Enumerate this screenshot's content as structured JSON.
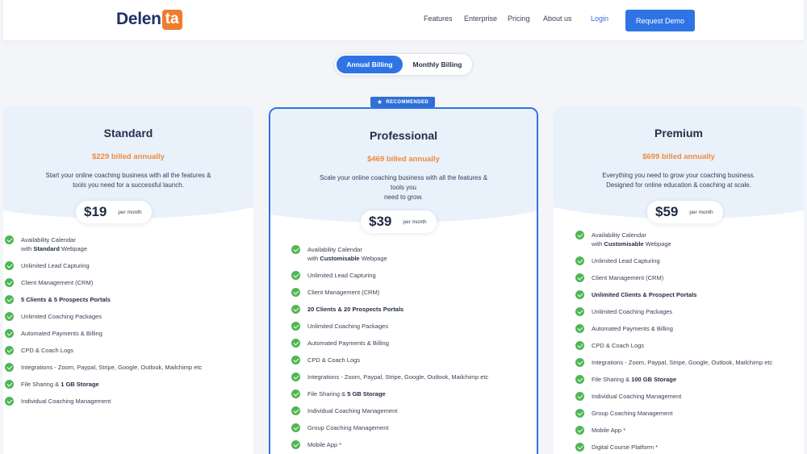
{
  "brand": {
    "logo_main": "Delen",
    "logo_tag": "ta"
  },
  "nav": {
    "items": [
      "Features",
      "Enterprise",
      "Pricing",
      "About us"
    ],
    "login": "Login",
    "demo": "Request  Demo"
  },
  "billing_toggle": {
    "annual": "Annual Billing",
    "monthly": "Monthly Billing",
    "selected": "Annual Billing"
  },
  "colors": {
    "accent": "#2f74e4",
    "orange": "#f08a3a",
    "check": "#4fb653",
    "navy": "#1f3168"
  },
  "plans": [
    {
      "name": "Standard",
      "billed": "$229 billed annually",
      "desc": [
        "Start your online coaching business with all the features &",
        "tools you need for a successful launch."
      ],
      "price": "$19",
      "per": "per month",
      "features": [
        {
          "pre": "Availability Calendar",
          "line2pre": "with ",
          "bold": "Standard",
          "post": " Webpage"
        },
        {
          "pre": "Unlimited Lead Capturing"
        },
        {
          "pre": "Client Management (CRM)"
        },
        {
          "bold": "5 Clients & 5 Prospects Portals"
        },
        {
          "pre": "Unlimited Coaching Packages"
        },
        {
          "pre": "Automated Payments & Billing"
        },
        {
          "pre": "CPD & Coach Logs"
        },
        {
          "pre": "Integrations - Zoom, Paypal, Stripe, Google, Outlook,  Mailchimp etc"
        },
        {
          "pre": "File Sharing & ",
          "bold": "1 GB Storage"
        },
        {
          "pre": "Individual Coaching Management"
        }
      ]
    },
    {
      "name": "Professional",
      "badge": "RECOMMENDED",
      "billed": "$469 billed annually",
      "desc": [
        "Scale your online coaching business with all the features &",
        "tools you",
        "need to grow."
      ],
      "price": "$39",
      "per": "per month",
      "features": [
        {
          "pre": "Availability Calendar",
          "line2pre": "with ",
          "bold": "Customisable",
          "post": " Webpage"
        },
        {
          "pre": "Unlimited Lead Capturing"
        },
        {
          "pre": "Client Management (CRM)"
        },
        {
          "bold": "20 Clients & 20 Prospects Portals"
        },
        {
          "pre": "Unlimited Coaching Packages"
        },
        {
          "pre": "Automated Payments & Billing"
        },
        {
          "pre": "CPD & Coach Logs"
        },
        {
          "pre": "Integrations - Zoom, Paypal, Stripe, Google, Outlook,  Mailchimp etc"
        },
        {
          "pre": "File Sharing & ",
          "bold": "5 GB Storage"
        },
        {
          "pre": "Individual Coaching Management"
        },
        {
          "pre": "Group Coaching Management"
        },
        {
          "pre": "Mobile App *"
        }
      ]
    },
    {
      "name": "Premium",
      "billed": "$699 billed annually",
      "desc": [
        "Everything you need to grow your coaching business.",
        "Designed for online education & coaching at scale."
      ],
      "price": "$59",
      "per": "per month",
      "features": [
        {
          "pre": "Availability Calendar",
          "line2pre": "with ",
          "bold": "Customisable",
          "post": " Webpage"
        },
        {
          "pre": "Unlimited Lead Capturing"
        },
        {
          "pre": "Client Management (CRM)"
        },
        {
          "bold": "Unlimited Clients & Prospect Portals"
        },
        {
          "pre": "Unlimited Coaching Packages"
        },
        {
          "pre": "Automated Payments & Billing"
        },
        {
          "pre": "CPD & Coach Logs"
        },
        {
          "pre": "Integrations - Zoom, Paypal, Stripe, Google, Outlook,  Mailchimp etc"
        },
        {
          "pre": "File Sharing & ",
          "bold": "100 GB Storage"
        },
        {
          "pre": "Individual Coaching Management"
        },
        {
          "pre": "Group Coaching Management"
        },
        {
          "pre": "Mobile App *"
        },
        {
          "pre": "Digital Course Platform *"
        }
      ]
    }
  ]
}
